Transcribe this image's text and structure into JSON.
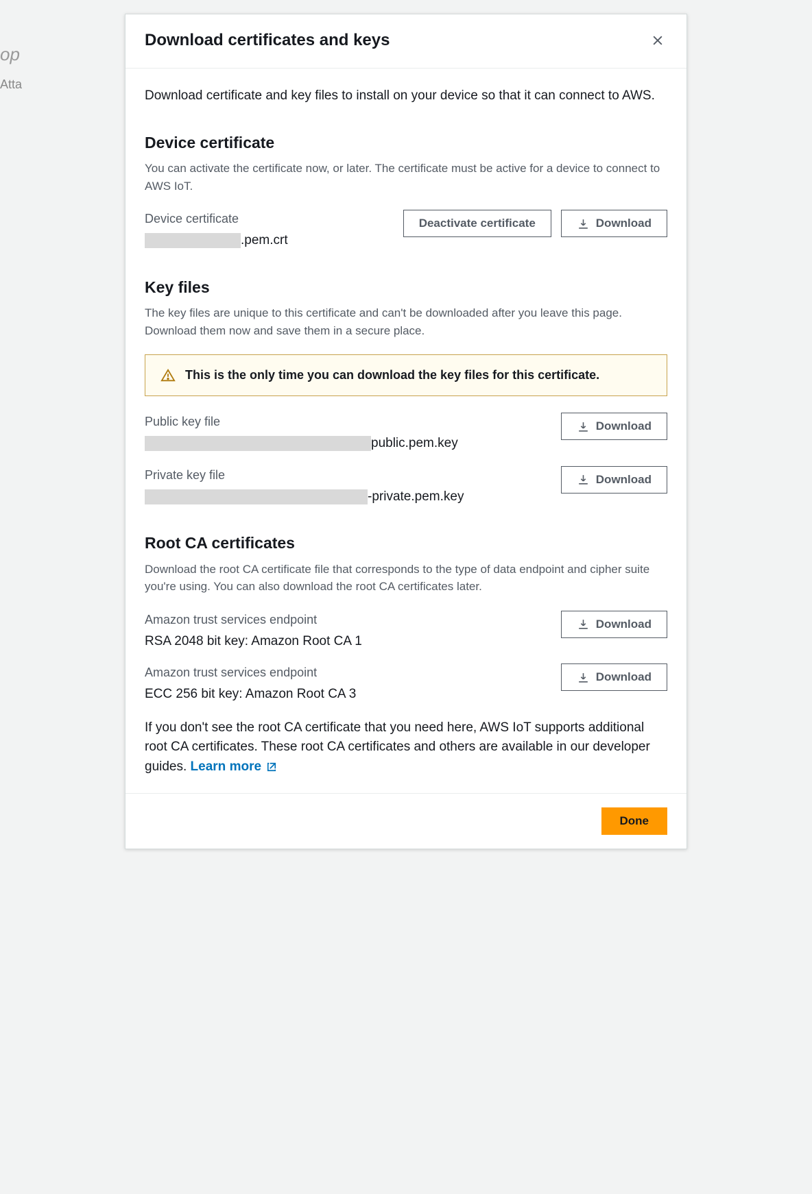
{
  "backdrop": {
    "title_fragment": "op",
    "subtitle_fragment": "Atta"
  },
  "modal": {
    "title": "Download certificates and keys",
    "intro": "Download certificate and key files to install on your device so that it can connect to AWS.",
    "footer": {
      "done": "Done"
    }
  },
  "device_cert": {
    "heading": "Device certificate",
    "desc": "You can activate the certificate now, or later. The certificate must be active for a device to connect to AWS IoT.",
    "label": "Device certificate",
    "file_suffix": ".pem.crt",
    "deactivate": "Deactivate certificate",
    "download": "Download"
  },
  "key_files": {
    "heading": "Key files",
    "desc": "The key files are unique to this certificate and can't be downloaded after you leave this page. Download them now and save them in a secure place.",
    "warning": "This is the only time you can download the key files for this certificate.",
    "public": {
      "label": "Public key file",
      "file_suffix": "public.pem.key",
      "download": "Download"
    },
    "private": {
      "label": "Private key file",
      "file_suffix": "-private.pem.key",
      "download": "Download"
    }
  },
  "root_ca": {
    "heading": "Root CA certificates",
    "desc": "Download the root CA certificate file that corresponds to the type of data endpoint and cipher suite you're using. You can also download the root CA certificates later.",
    "items": [
      {
        "label": "Amazon trust services endpoint",
        "value": "RSA 2048 bit key: Amazon Root CA 1",
        "download": "Download"
      },
      {
        "label": "Amazon trust services endpoint",
        "value": "ECC 256 bit key: Amazon Root CA 3",
        "download": "Download"
      }
    ],
    "footer_text": "If you don't see the root CA certificate that you need here, AWS IoT supports additional root CA certificates. These root CA certificates and others are available in our developer guides. ",
    "learn_more": "Learn more"
  }
}
